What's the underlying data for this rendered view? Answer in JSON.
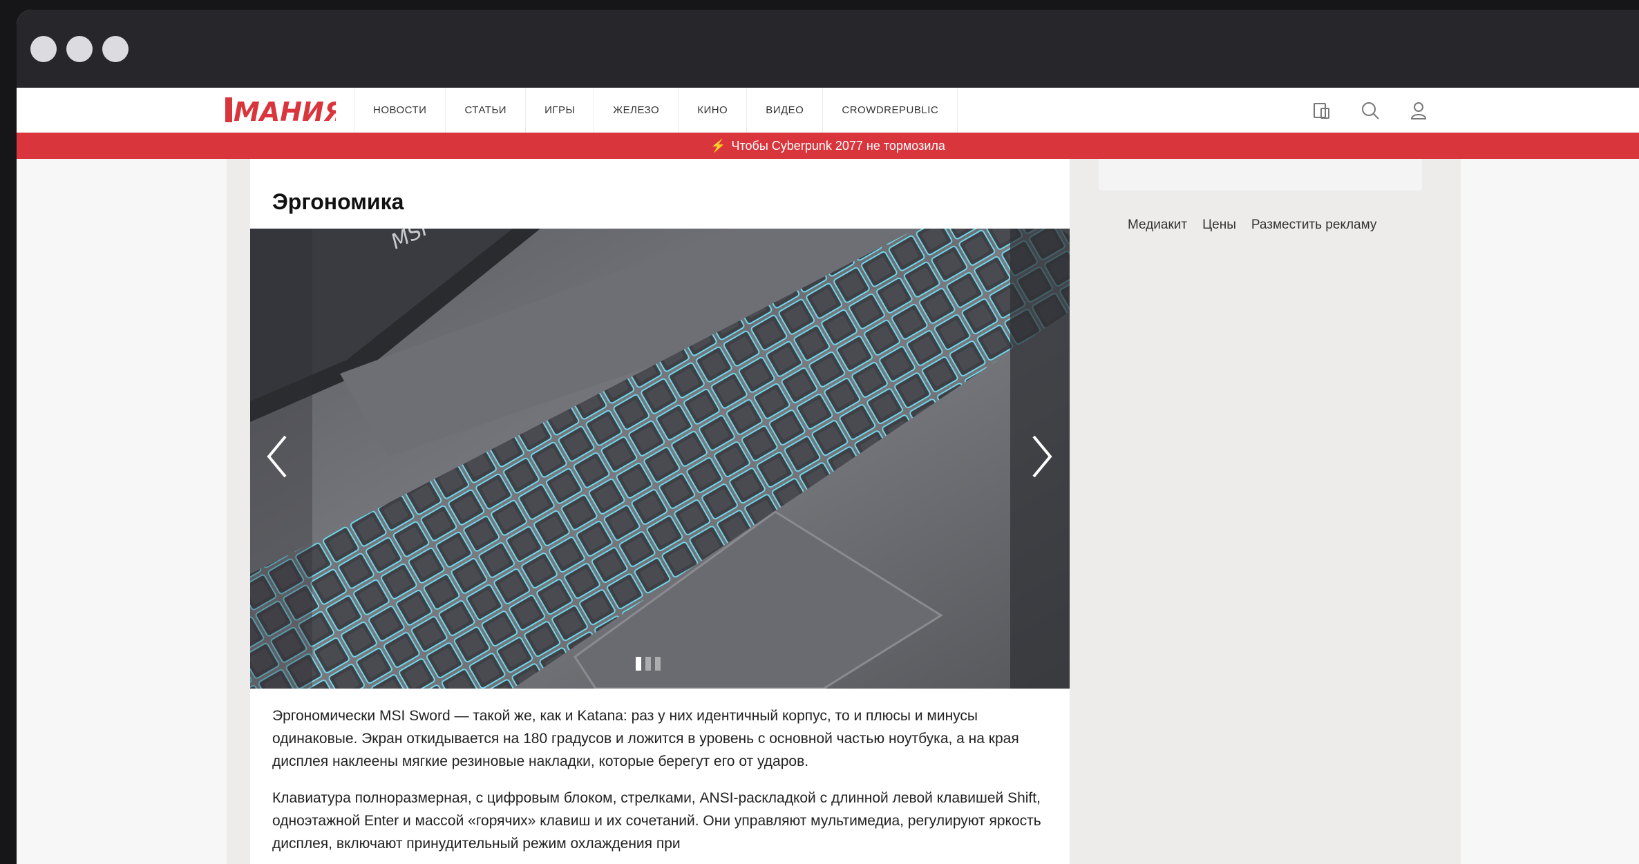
{
  "logo_text": "МАНИЯ",
  "nav": {
    "items": [
      "Новости",
      "Статьи",
      "Игры",
      "Железо",
      "Кино",
      "Видео",
      "Crowdrepublic"
    ]
  },
  "icons": {
    "device": "device-icon",
    "search": "search-icon",
    "user": "user-icon",
    "promo": "lightning-icon",
    "prev": "chevron-left-icon",
    "next": "chevron-right-icon"
  },
  "promo": {
    "text": "Чтобы Cyberpunk 2077 не тормозила"
  },
  "article": {
    "heading": "Эргономика",
    "paragraphs": [
      "Эргономически MSI Sword — такой же, как и Katana: раз у них идентичный корпус, то и плюсы и минусы одинаковые. Экран откидывается на 180 градусов и ложится в уровень с основной частью ноутбука, а на края дисплея наклеены мягкие резиновые накладки, которые берегут его от ударов.",
      "Клавиатура полноразмерная, с цифровым блоком, стрелками, ANSI-раскладкой с длинной левой клавишей Shift, одноэтажной Enter и массой «горячих» клавиш и их сочетаний. Они управляют мультимедиа, регулируют яркость дисплея, включают принудительный режим охлаждения при"
    ]
  },
  "gallery": {
    "image_text": "MSI",
    "slide_count": 3,
    "active_slide": 1
  },
  "sidebar": {
    "links": [
      "Медиакит",
      "Цены",
      "Разместить рекламу"
    ]
  },
  "colors": {
    "brand_red": "#d9353c",
    "titlebar": "#27262b",
    "key_glow": "#6fd6ea"
  }
}
